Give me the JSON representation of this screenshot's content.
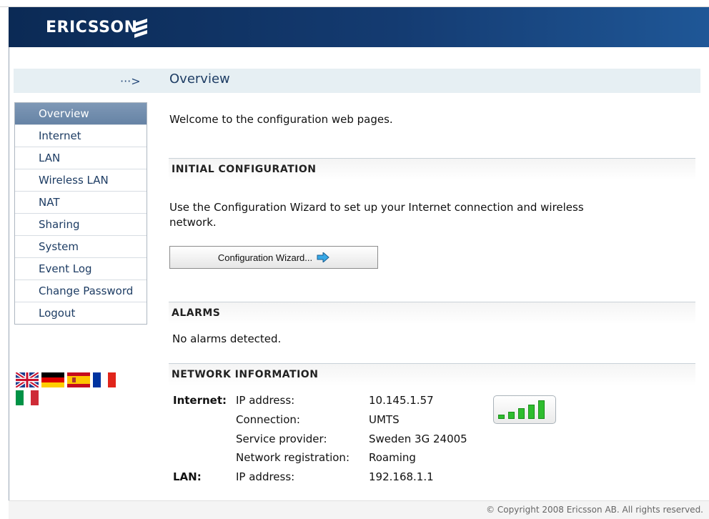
{
  "header": {
    "logo_text": "ERICSSON",
    "logo_mark": "ericsson-stripes-icon"
  },
  "title": {
    "arrow": "···>",
    "text": "Overview"
  },
  "sidebar": {
    "items": [
      {
        "label": "Overview",
        "active": true
      },
      {
        "label": "Internet"
      },
      {
        "label": "LAN"
      },
      {
        "label": "Wireless LAN"
      },
      {
        "label": "NAT"
      },
      {
        "label": "Sharing"
      },
      {
        "label": "System"
      },
      {
        "label": "Event Log"
      },
      {
        "label": "Change Password"
      },
      {
        "label": "Logout"
      }
    ]
  },
  "languages": [
    {
      "icon": "uk-flag-icon"
    },
    {
      "icon": "germany-flag-icon"
    },
    {
      "icon": "spain-flag-icon"
    },
    {
      "icon": "france-flag-icon"
    },
    {
      "icon": "italy-flag-icon"
    }
  ],
  "main": {
    "welcome": "Welcome to the configuration web pages.",
    "initial": {
      "title": "INITIAL CONFIGURATION",
      "desc_line1": "Use the Configuration Wizard to set up your Internet connection and wireless",
      "desc_line2": "network.",
      "button_label": "Configuration Wizard..."
    },
    "alarms": {
      "title": "ALARMS",
      "text": "No alarms detected."
    },
    "network": {
      "title": "NETWORK INFORMATION",
      "internet_label": "Internet:",
      "lan_label": "LAN:",
      "rows": [
        {
          "key": "IP address:",
          "value": "10.145.1.57"
        },
        {
          "key": "Connection:",
          "value": "UMTS"
        },
        {
          "key": "Service provider:",
          "value": "Sweden 3G 24005"
        },
        {
          "key": "Network registration:",
          "value": "Roaming"
        }
      ],
      "lan_row": {
        "key": "IP address:",
        "value": "192.168.1.1"
      },
      "signal_bars": 5,
      "signal_color": "#2fbd2f"
    }
  },
  "footer": {
    "copyright": "© Copyright 2008 Ericsson AB. All rights reserved."
  }
}
